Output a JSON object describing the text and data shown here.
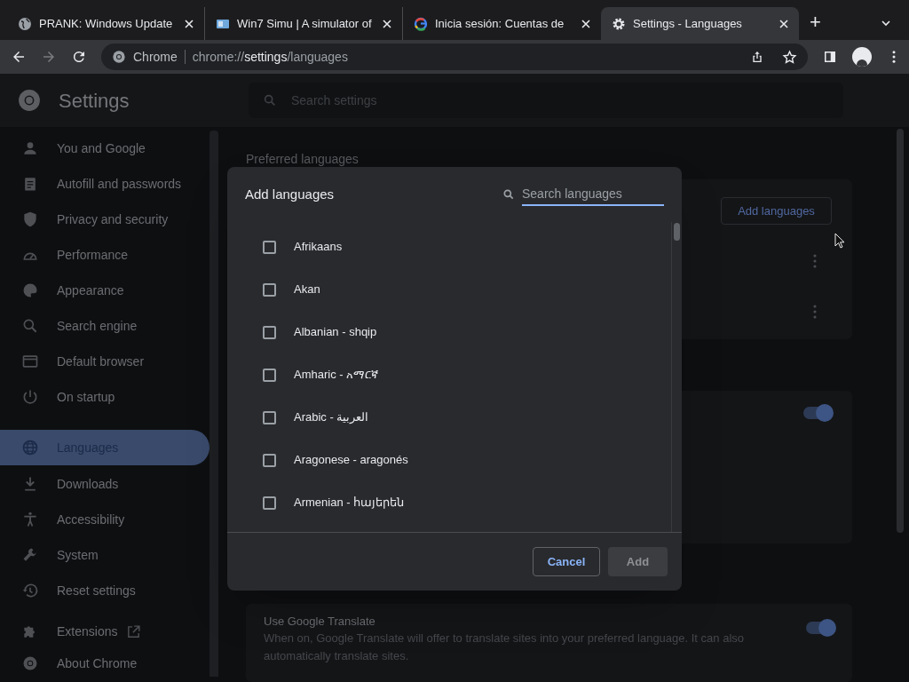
{
  "tabs": [
    {
      "kind": "globe",
      "title": "PRANK: Windows Update",
      "selected": false
    },
    {
      "kind": "app",
      "title": "Win7 Simu | A simulator of",
      "selected": false
    },
    {
      "kind": "google",
      "title": "Inicia sesión: Cuentas de",
      "selected": false
    },
    {
      "kind": "gear",
      "title": "Settings - Languages",
      "selected": true
    }
  ],
  "new_tab": "+",
  "toolbar": {
    "site_label": "Chrome",
    "url": {
      "scheme": "chrome://",
      "host": "settings",
      "path": "/languages"
    }
  },
  "header": {
    "title": "Settings",
    "search": {
      "placeholder": "Search settings"
    }
  },
  "sidebar": {
    "items": [
      {
        "kind": "person",
        "label": "You and Google",
        "selected": false
      },
      {
        "kind": "clipboard",
        "label": "Autofill and passwords",
        "selected": false
      },
      {
        "kind": "shield",
        "label": "Privacy and security",
        "selected": false
      },
      {
        "kind": "gauge",
        "label": "Performance",
        "selected": false
      },
      {
        "kind": "palette",
        "label": "Appearance",
        "selected": false
      },
      {
        "kind": "search",
        "label": "Search engine",
        "selected": false
      },
      {
        "kind": "browser",
        "label": "Default browser",
        "selected": false
      },
      {
        "kind": "power",
        "label": "On startup",
        "selected": false
      },
      {
        "kind": "globe",
        "label": "Languages",
        "selected": true
      },
      {
        "kind": "download",
        "label": "Downloads",
        "selected": false
      },
      {
        "kind": "accessibility",
        "label": "Accessibility",
        "selected": false
      },
      {
        "kind": "wrench",
        "label": "System",
        "selected": false
      },
      {
        "kind": "history",
        "label": "Reset settings",
        "selected": false
      },
      {
        "kind": "puzzle",
        "label": "Extensions",
        "selected": false,
        "external": true
      },
      {
        "kind": "chrome",
        "label": "About Chrome",
        "selected": false
      }
    ]
  },
  "content": {
    "section_title": "Preferred languages",
    "add_button": "Add languages",
    "spell_toggle": {
      "on": true
    },
    "translate": {
      "title": "Use Google Translate",
      "description": "When on, Google Translate will offer to translate sites into your preferred language. It can also automatically translate sites.",
      "on": true
    }
  },
  "dialog": {
    "title": "Add languages",
    "search": {
      "placeholder": "Search languages"
    },
    "languages": [
      {
        "label": "Afrikaans",
        "checked": false
      },
      {
        "label": "Akan",
        "checked": false
      },
      {
        "label": "Albanian - shqip",
        "checked": false
      },
      {
        "label": "Amharic - አማርኛ",
        "checked": false
      },
      {
        "label": "Arabic - العربية",
        "checked": false
      },
      {
        "label": "Aragonese - aragonés",
        "checked": false
      },
      {
        "label": "Armenian - հայերեն",
        "checked": false
      }
    ],
    "buttons": [
      {
        "kind": "secondary",
        "label": "Cancel",
        "disabled": false
      },
      {
        "kind": "primary",
        "label": "Add",
        "disabled": true
      }
    ]
  }
}
